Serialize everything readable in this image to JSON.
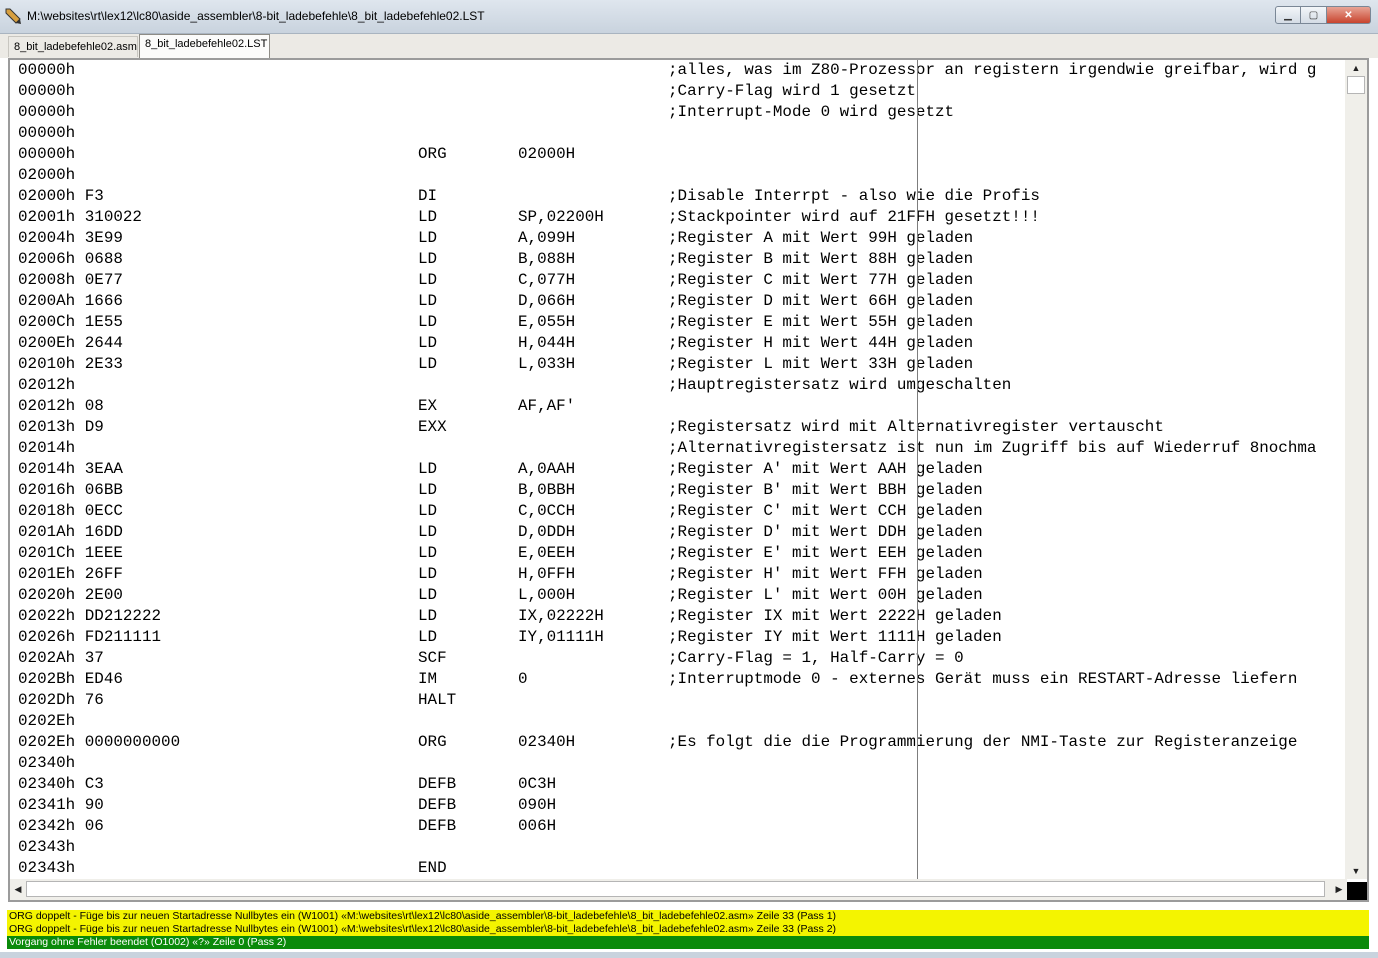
{
  "window": {
    "title": "M:\\websites\\rt\\lex12\\lc80\\aside_assembler\\8-bit_ladebefehle\\8_bit_ladebefehle02.LST",
    "icon": "pen-icon",
    "minimize_glyph": "▁",
    "maximize_glyph": "▢",
    "close_glyph": "✕"
  },
  "tabs": [
    {
      "label": "8_bit_ladebefehle02.asm",
      "active": false
    },
    {
      "label": "8_bit_ladebefehle02.LST",
      "active": true
    }
  ],
  "listing": [
    {
      "addr": "00000h",
      "mn": "",
      "op": "",
      "cm": ";alles, was im Z80-Prozessor an registern irgendwie greifbar, wird g"
    },
    {
      "addr": "00000h",
      "mn": "",
      "op": "",
      "cm": ";Carry-Flag wird 1 gesetzt"
    },
    {
      "addr": "00000h",
      "mn": "",
      "op": "",
      "cm": ";Interrupt-Mode 0 wird gesetzt"
    },
    {
      "addr": "00000h",
      "mn": "",
      "op": "",
      "cm": ""
    },
    {
      "addr": "00000h",
      "mn": "ORG",
      "op": "02000H",
      "cm": ""
    },
    {
      "addr": "02000h",
      "mn": "",
      "op": "",
      "cm": ""
    },
    {
      "addr": "02000h F3",
      "mn": "DI",
      "op": "",
      "cm": ";Disable Interrpt - also wie die Profis"
    },
    {
      "addr": "02001h 310022",
      "mn": "LD",
      "op": "SP,02200H",
      "cm": ";Stackpointer wird auf 21FFH gesetzt!!!"
    },
    {
      "addr": "02004h 3E99",
      "mn": "LD",
      "op": "A,099H",
      "cm": ";Register A mit Wert 99H geladen"
    },
    {
      "addr": "02006h 0688",
      "mn": "LD",
      "op": "B,088H",
      "cm": ";Register B mit Wert 88H geladen"
    },
    {
      "addr": "02008h 0E77",
      "mn": "LD",
      "op": "C,077H",
      "cm": ";Register C mit Wert 77H geladen"
    },
    {
      "addr": "0200Ah 1666",
      "mn": "LD",
      "op": "D,066H",
      "cm": ";Register D mit Wert 66H geladen"
    },
    {
      "addr": "0200Ch 1E55",
      "mn": "LD",
      "op": "E,055H",
      "cm": ";Register E mit Wert 55H geladen"
    },
    {
      "addr": "0200Eh 2644",
      "mn": "LD",
      "op": "H,044H",
      "cm": ";Register H mit Wert 44H geladen"
    },
    {
      "addr": "02010h 2E33",
      "mn": "LD",
      "op": "L,033H",
      "cm": ";Register L mit Wert 33H geladen"
    },
    {
      "addr": "02012h",
      "mn": "",
      "op": "",
      "cm": ";Hauptregistersatz wird umgeschalten"
    },
    {
      "addr": "02012h 08",
      "mn": "EX",
      "op": "AF,AF'",
      "cm": ""
    },
    {
      "addr": "02013h D9",
      "mn": "EXX",
      "op": "",
      "cm": ";Registersatz wird mit Alternativregister vertauscht"
    },
    {
      "addr": "02014h",
      "mn": "",
      "op": "",
      "cm": ";Alternativregistersatz ist nun im Zugriff bis auf Wiederruf 8nochma"
    },
    {
      "addr": "02014h 3EAA",
      "mn": "LD",
      "op": "A,0AAH",
      "cm": ";Register A' mit Wert AAH geladen"
    },
    {
      "addr": "02016h 06BB",
      "mn": "LD",
      "op": "B,0BBH",
      "cm": ";Register B' mit Wert BBH geladen"
    },
    {
      "addr": "02018h 0ECC",
      "mn": "LD",
      "op": "C,0CCH",
      "cm": ";Register C' mit Wert CCH geladen"
    },
    {
      "addr": "0201Ah 16DD",
      "mn": "LD",
      "op": "D,0DDH",
      "cm": ";Register D' mit Wert DDH geladen"
    },
    {
      "addr": "0201Ch 1EEE",
      "mn": "LD",
      "op": "E,0EEH",
      "cm": ";Register E' mit Wert EEH geladen"
    },
    {
      "addr": "0201Eh 26FF",
      "mn": "LD",
      "op": "H,0FFH",
      "cm": ";Register H' mit Wert FFH geladen"
    },
    {
      "addr": "02020h 2E00",
      "mn": "LD",
      "op": "L,000H",
      "cm": ";Register L' mit Wert 00H geladen"
    },
    {
      "addr": "02022h DD212222",
      "mn": "LD",
      "op": "IX,02222H",
      "cm": ";Register IX mit Wert 2222H geladen"
    },
    {
      "addr": "02026h FD211111",
      "mn": "LD",
      "op": "IY,01111H",
      "cm": ";Register IY mit Wert 1111H geladen"
    },
    {
      "addr": "0202Ah 37",
      "mn": "SCF",
      "op": "",
      "cm": ";Carry-Flag = 1, Half-Carry = 0"
    },
    {
      "addr": "0202Bh ED46",
      "mn": "IM",
      "op": "0",
      "cm": ";Interruptmode 0 - externes Gerät muss ein RESTART-Adresse liefern"
    },
    {
      "addr": "0202Dh 76",
      "mn": "HALT",
      "op": "",
      "cm": ""
    },
    {
      "addr": "0202Eh",
      "mn": "",
      "op": "",
      "cm": ""
    },
    {
      "addr": "0202Eh 0000000000",
      "mn": "ORG",
      "op": "02340H",
      "cm": ";Es folgt die die Programmierung der NMI-Taste zur Registeranzeige"
    },
    {
      "addr": "02340h",
      "mn": "",
      "op": "",
      "cm": ""
    },
    {
      "addr": "02340h C3",
      "mn": "DEFB",
      "op": "0C3H",
      "cm": ""
    },
    {
      "addr": "02341h 90",
      "mn": "DEFB",
      "op": "090H",
      "cm": ""
    },
    {
      "addr": "02342h 06",
      "mn": "DEFB",
      "op": "006H",
      "cm": ""
    },
    {
      "addr": "02343h",
      "mn": "",
      "op": "",
      "cm": ""
    },
    {
      "addr": "02343h",
      "mn": "END",
      "op": "",
      "cm": ""
    }
  ],
  "scrollbars": {
    "up_glyph": "▲",
    "down_glyph": "▼",
    "left_glyph": "◀",
    "right_glyph": "▶"
  },
  "messages": [
    {
      "type": "warning",
      "text": "ORG doppelt - Füge bis zur neuen Startadresse Nullbytes ein (W1001) «M:\\websites\\rt\\lex12\\lc80\\aside_assembler\\8-bit_ladebefehle\\8_bit_ladebefehle02.asm» Zeile 33 (Pass 1)"
    },
    {
      "type": "warning",
      "text": "ORG doppelt - Füge bis zur neuen Startadresse Nullbytes ein (W1001) «M:\\websites\\rt\\lex12\\lc80\\aside_assembler\\8-bit_ladebefehle\\8_bit_ladebefehle02.asm» Zeile 33 (Pass 2)"
    },
    {
      "type": "ok",
      "text": "Vorgang ohne Fehler beendet (O1002) «?» Zeile 0 (Pass 2)"
    }
  ],
  "colors": {
    "warning_bg": "#f4f400",
    "ok_bg": "#0a8a0a"
  }
}
